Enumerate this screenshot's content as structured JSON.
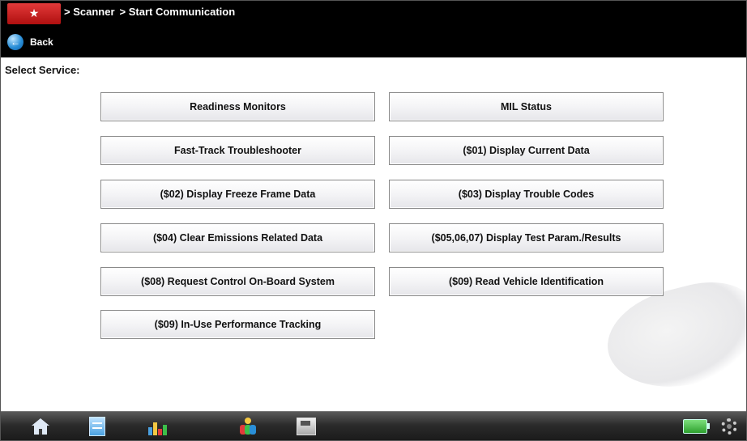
{
  "header": {
    "logo_text": "★",
    "breadcrumb": [
      "> Scanner",
      "> Start Communication"
    ],
    "back_label": "Back"
  },
  "main": {
    "select_label": "Select Service:",
    "services": [
      {
        "label": "Readiness Monitors"
      },
      {
        "label": "MIL Status"
      },
      {
        "label": "Fast-Track Troubleshooter"
      },
      {
        "label": "($01) Display Current Data"
      },
      {
        "label": "($02) Display Freeze Frame Data"
      },
      {
        "label": "($03) Display Trouble Codes"
      },
      {
        "label": "($04) Clear Emissions Related Data"
      },
      {
        "label": "($05,06,07) Display Test Param./Results"
      },
      {
        "label": "($08) Request Control On-Board System"
      },
      {
        "label": "($09) Read Vehicle Identification"
      },
      {
        "label": "($09) In-Use Performance Tracking"
      }
    ]
  },
  "toolbar": {
    "icons": [
      "home-icon",
      "data-list-icon",
      "chart-icon",
      "person-icon",
      "save-icon",
      "battery-icon",
      "settings-icon"
    ]
  },
  "colors": {
    "header_bg": "#000000",
    "button_border": "#888888",
    "toolbar_bg": "#2b2b2b",
    "logo_red": "#e23a3a"
  }
}
